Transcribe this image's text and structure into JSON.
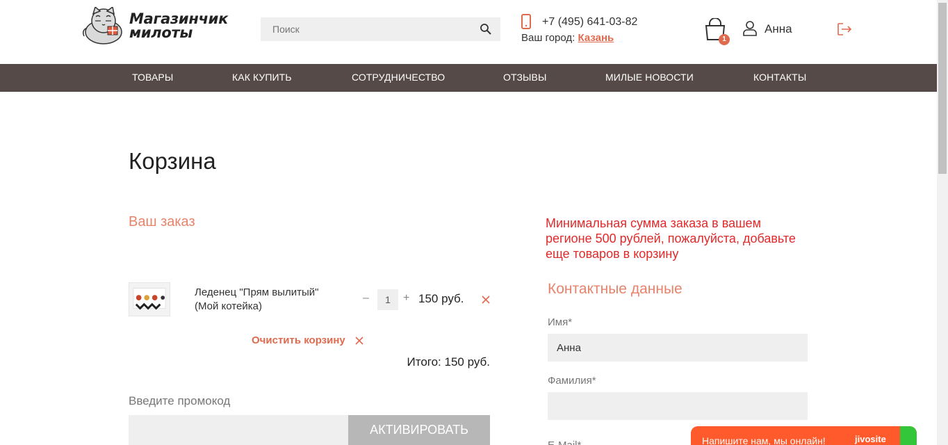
{
  "header": {
    "logo_line1": "Магазинчик",
    "logo_line2": "милоты",
    "search_placeholder": "Поиск",
    "phone": "+7 (495) 641-03-82",
    "city_label": "Ваш город:",
    "city_value": "Казань",
    "cart_count": "1",
    "user_name": "Анна"
  },
  "nav": {
    "items": [
      "ТОВАРЫ",
      "КАК КУПИТЬ",
      "СОТРУДНИЧЕСТВО",
      "ОТЗЫВЫ",
      "МИЛЫЕ НОВОСТИ",
      "КОНТАКТЫ"
    ]
  },
  "page": {
    "title": "Корзина",
    "order_heading": "Ваш заказ"
  },
  "cart": {
    "items": [
      {
        "name": "Леденец \"Прям вылитый\" (Мой котейка)",
        "qty_minus": "–",
        "qty": "1",
        "qty_plus": "+",
        "price": "150 руб."
      }
    ],
    "clear_label": "Очистить корзину",
    "total": "Итого: 150 руб."
  },
  "promo": {
    "label": "Введите промокод",
    "button": "АКТИВИРОВАТЬ"
  },
  "notice": {
    "min_order": "Минимальная сумма заказа в вашем регионе 500 рублей, пожалуйста, добавьте еще товаров в корзину"
  },
  "contact": {
    "heading": "Контактные данные",
    "first_name_label": "Имя*",
    "first_name_value": "Анна",
    "last_name_label": "Фамилия*",
    "last_name_value": "",
    "email_label": "E-Mail*"
  },
  "chat": {
    "text": "Напишите нам, мы онлайн!",
    "brand": "jivosite"
  },
  "colors": {
    "accent": "#e06a4e",
    "nav_bg": "#564a48",
    "warning": "#e02a2a",
    "chat": "#ff5a2c"
  }
}
